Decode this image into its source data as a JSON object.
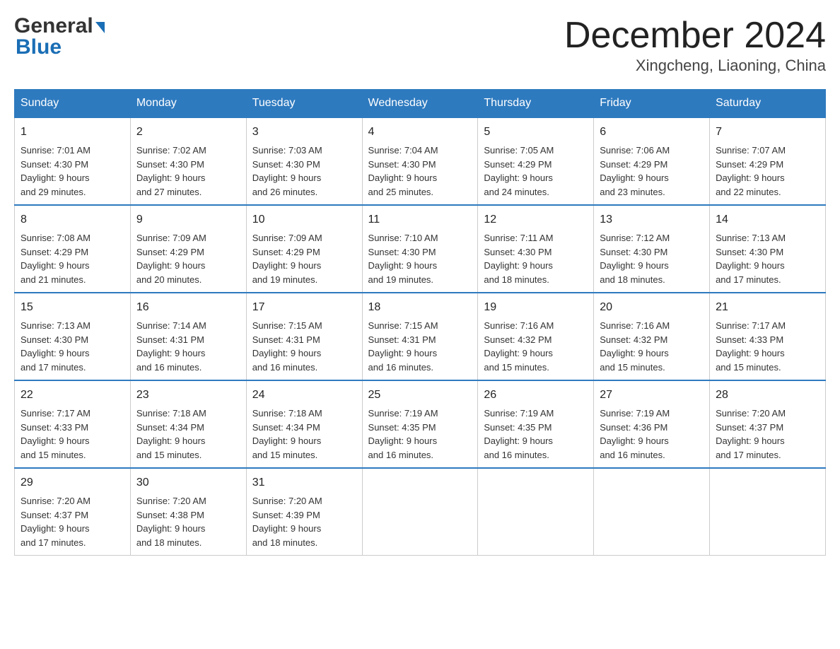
{
  "logo": {
    "general": "General",
    "blue": "Blue",
    "arrow": "▶"
  },
  "header": {
    "month_title": "December 2024",
    "location": "Xingcheng, Liaoning, China"
  },
  "weekdays": [
    "Sunday",
    "Monday",
    "Tuesday",
    "Wednesday",
    "Thursday",
    "Friday",
    "Saturday"
  ],
  "weeks": [
    [
      {
        "day": "1",
        "sunrise": "Sunrise: 7:01 AM",
        "sunset": "Sunset: 4:30 PM",
        "daylight": "Daylight: 9 hours",
        "minutes": "and 29 minutes."
      },
      {
        "day": "2",
        "sunrise": "Sunrise: 7:02 AM",
        "sunset": "Sunset: 4:30 PM",
        "daylight": "Daylight: 9 hours",
        "minutes": "and 27 minutes."
      },
      {
        "day": "3",
        "sunrise": "Sunrise: 7:03 AM",
        "sunset": "Sunset: 4:30 PM",
        "daylight": "Daylight: 9 hours",
        "minutes": "and 26 minutes."
      },
      {
        "day": "4",
        "sunrise": "Sunrise: 7:04 AM",
        "sunset": "Sunset: 4:30 PM",
        "daylight": "Daylight: 9 hours",
        "minutes": "and 25 minutes."
      },
      {
        "day": "5",
        "sunrise": "Sunrise: 7:05 AM",
        "sunset": "Sunset: 4:29 PM",
        "daylight": "Daylight: 9 hours",
        "minutes": "and 24 minutes."
      },
      {
        "day": "6",
        "sunrise": "Sunrise: 7:06 AM",
        "sunset": "Sunset: 4:29 PM",
        "daylight": "Daylight: 9 hours",
        "minutes": "and 23 minutes."
      },
      {
        "day": "7",
        "sunrise": "Sunrise: 7:07 AM",
        "sunset": "Sunset: 4:29 PM",
        "daylight": "Daylight: 9 hours",
        "minutes": "and 22 minutes."
      }
    ],
    [
      {
        "day": "8",
        "sunrise": "Sunrise: 7:08 AM",
        "sunset": "Sunset: 4:29 PM",
        "daylight": "Daylight: 9 hours",
        "minutes": "and 21 minutes."
      },
      {
        "day": "9",
        "sunrise": "Sunrise: 7:09 AM",
        "sunset": "Sunset: 4:29 PM",
        "daylight": "Daylight: 9 hours",
        "minutes": "and 20 minutes."
      },
      {
        "day": "10",
        "sunrise": "Sunrise: 7:09 AM",
        "sunset": "Sunset: 4:29 PM",
        "daylight": "Daylight: 9 hours",
        "minutes": "and 19 minutes."
      },
      {
        "day": "11",
        "sunrise": "Sunrise: 7:10 AM",
        "sunset": "Sunset: 4:30 PM",
        "daylight": "Daylight: 9 hours",
        "minutes": "and 19 minutes."
      },
      {
        "day": "12",
        "sunrise": "Sunrise: 7:11 AM",
        "sunset": "Sunset: 4:30 PM",
        "daylight": "Daylight: 9 hours",
        "minutes": "and 18 minutes."
      },
      {
        "day": "13",
        "sunrise": "Sunrise: 7:12 AM",
        "sunset": "Sunset: 4:30 PM",
        "daylight": "Daylight: 9 hours",
        "minutes": "and 18 minutes."
      },
      {
        "day": "14",
        "sunrise": "Sunrise: 7:13 AM",
        "sunset": "Sunset: 4:30 PM",
        "daylight": "Daylight: 9 hours",
        "minutes": "and 17 minutes."
      }
    ],
    [
      {
        "day": "15",
        "sunrise": "Sunrise: 7:13 AM",
        "sunset": "Sunset: 4:30 PM",
        "daylight": "Daylight: 9 hours",
        "minutes": "and 17 minutes."
      },
      {
        "day": "16",
        "sunrise": "Sunrise: 7:14 AM",
        "sunset": "Sunset: 4:31 PM",
        "daylight": "Daylight: 9 hours",
        "minutes": "and 16 minutes."
      },
      {
        "day": "17",
        "sunrise": "Sunrise: 7:15 AM",
        "sunset": "Sunset: 4:31 PM",
        "daylight": "Daylight: 9 hours",
        "minutes": "and 16 minutes."
      },
      {
        "day": "18",
        "sunrise": "Sunrise: 7:15 AM",
        "sunset": "Sunset: 4:31 PM",
        "daylight": "Daylight: 9 hours",
        "minutes": "and 16 minutes."
      },
      {
        "day": "19",
        "sunrise": "Sunrise: 7:16 AM",
        "sunset": "Sunset: 4:32 PM",
        "daylight": "Daylight: 9 hours",
        "minutes": "and 15 minutes."
      },
      {
        "day": "20",
        "sunrise": "Sunrise: 7:16 AM",
        "sunset": "Sunset: 4:32 PM",
        "daylight": "Daylight: 9 hours",
        "minutes": "and 15 minutes."
      },
      {
        "day": "21",
        "sunrise": "Sunrise: 7:17 AM",
        "sunset": "Sunset: 4:33 PM",
        "daylight": "Daylight: 9 hours",
        "minutes": "and 15 minutes."
      }
    ],
    [
      {
        "day": "22",
        "sunrise": "Sunrise: 7:17 AM",
        "sunset": "Sunset: 4:33 PM",
        "daylight": "Daylight: 9 hours",
        "minutes": "and 15 minutes."
      },
      {
        "day": "23",
        "sunrise": "Sunrise: 7:18 AM",
        "sunset": "Sunset: 4:34 PM",
        "daylight": "Daylight: 9 hours",
        "minutes": "and 15 minutes."
      },
      {
        "day": "24",
        "sunrise": "Sunrise: 7:18 AM",
        "sunset": "Sunset: 4:34 PM",
        "daylight": "Daylight: 9 hours",
        "minutes": "and 15 minutes."
      },
      {
        "day": "25",
        "sunrise": "Sunrise: 7:19 AM",
        "sunset": "Sunset: 4:35 PM",
        "daylight": "Daylight: 9 hours",
        "minutes": "and 16 minutes."
      },
      {
        "day": "26",
        "sunrise": "Sunrise: 7:19 AM",
        "sunset": "Sunset: 4:35 PM",
        "daylight": "Daylight: 9 hours",
        "minutes": "and 16 minutes."
      },
      {
        "day": "27",
        "sunrise": "Sunrise: 7:19 AM",
        "sunset": "Sunset: 4:36 PM",
        "daylight": "Daylight: 9 hours",
        "minutes": "and 16 minutes."
      },
      {
        "day": "28",
        "sunrise": "Sunrise: 7:20 AM",
        "sunset": "Sunset: 4:37 PM",
        "daylight": "Daylight: 9 hours",
        "minutes": "and 17 minutes."
      }
    ],
    [
      {
        "day": "29",
        "sunrise": "Sunrise: 7:20 AM",
        "sunset": "Sunset: 4:37 PM",
        "daylight": "Daylight: 9 hours",
        "minutes": "and 17 minutes."
      },
      {
        "day": "30",
        "sunrise": "Sunrise: 7:20 AM",
        "sunset": "Sunset: 4:38 PM",
        "daylight": "Daylight: 9 hours",
        "minutes": "and 18 minutes."
      },
      {
        "day": "31",
        "sunrise": "Sunrise: 7:20 AM",
        "sunset": "Sunset: 4:39 PM",
        "daylight": "Daylight: 9 hours",
        "minutes": "and 18 minutes."
      },
      null,
      null,
      null,
      null
    ]
  ]
}
